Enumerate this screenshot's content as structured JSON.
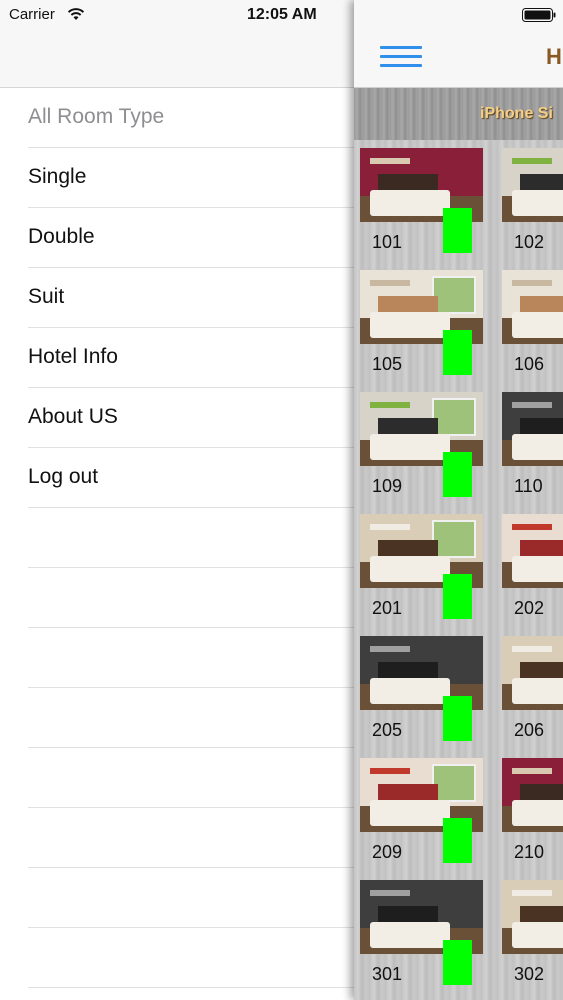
{
  "status_bar": {
    "carrier": "Carrier",
    "time": "12:05 AM"
  },
  "nav": {
    "title": "H"
  },
  "banner": {
    "text": "iPhone Si"
  },
  "menu": {
    "items": [
      {
        "label": "All Room Type",
        "muted": true
      },
      {
        "label": "Single"
      },
      {
        "label": "Double"
      },
      {
        "label": "Suit"
      },
      {
        "label": "Hotel Info"
      },
      {
        "label": "About US"
      },
      {
        "label": "Log out"
      }
    ],
    "empty_rows": 8
  },
  "rooms": [
    {
      "number": "101",
      "style": "maroon"
    },
    {
      "number": "102",
      "style": "green"
    },
    {
      "number": "105",
      "style": "white"
    },
    {
      "number": "106",
      "style": "white"
    },
    {
      "number": "109",
      "style": "green"
    },
    {
      "number": "110",
      "style": "dark"
    },
    {
      "number": "201",
      "style": "beige"
    },
    {
      "number": "202",
      "style": "red"
    },
    {
      "number": "205",
      "style": "dark"
    },
    {
      "number": "206",
      "style": "beige"
    },
    {
      "number": "209",
      "style": "red"
    },
    {
      "number": "210",
      "style": "maroon"
    },
    {
      "number": "301",
      "style": "dark"
    },
    {
      "number": "302",
      "style": "beige"
    }
  ],
  "colors": {
    "available": "#00ff00",
    "hamburger": "#2f8fea",
    "title": "#8a5a24",
    "banner_text": "#f3cf8a"
  },
  "icons": {
    "wifi": "wifi-icon",
    "battery": "battery-icon",
    "menu": "hamburger-icon"
  }
}
